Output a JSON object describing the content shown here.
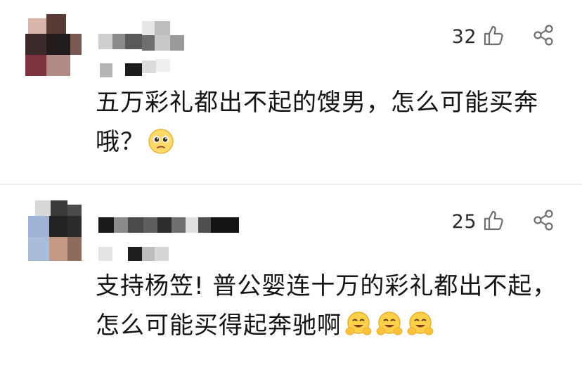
{
  "comments": [
    {
      "likes": "32",
      "text": "五万彩礼都出不起的馊男，怎么可能买奔哦？",
      "emojis": [
        "pleading-face-emoji"
      ]
    },
    {
      "likes": "25",
      "text": "支持杨笠! 普公婴连十万的彩礼都出不起，怎么可能买得起奔驰啊",
      "emojis": [
        "hugging-face-emoji",
        "hugging-face-emoji",
        "hugging-face-emoji"
      ]
    }
  ],
  "icons": {
    "like": "thumbs-up-outline-icon",
    "share": "share-nodes-icon"
  },
  "colors": {
    "background": "#ffffff",
    "text": "#141414",
    "icon": "#6f6f6f",
    "divider": "#f1f1f1"
  }
}
